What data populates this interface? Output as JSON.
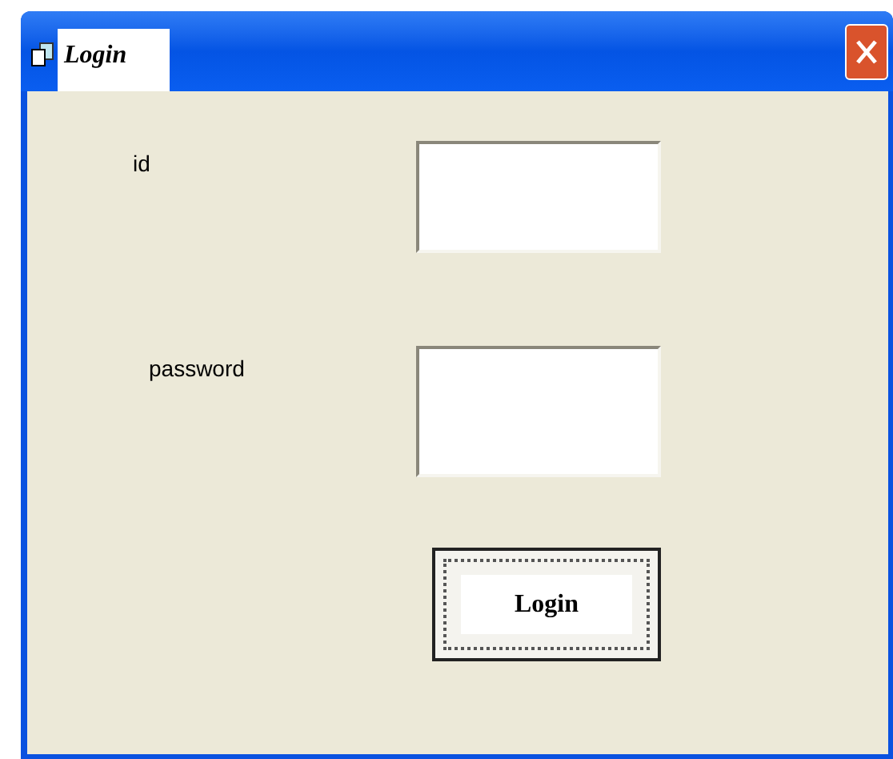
{
  "window": {
    "title": "Login"
  },
  "fields": [
    {
      "label": "id"
    },
    {
      "label": "password"
    }
  ],
  "button": {
    "label": "Login",
    "focused": true
  }
}
